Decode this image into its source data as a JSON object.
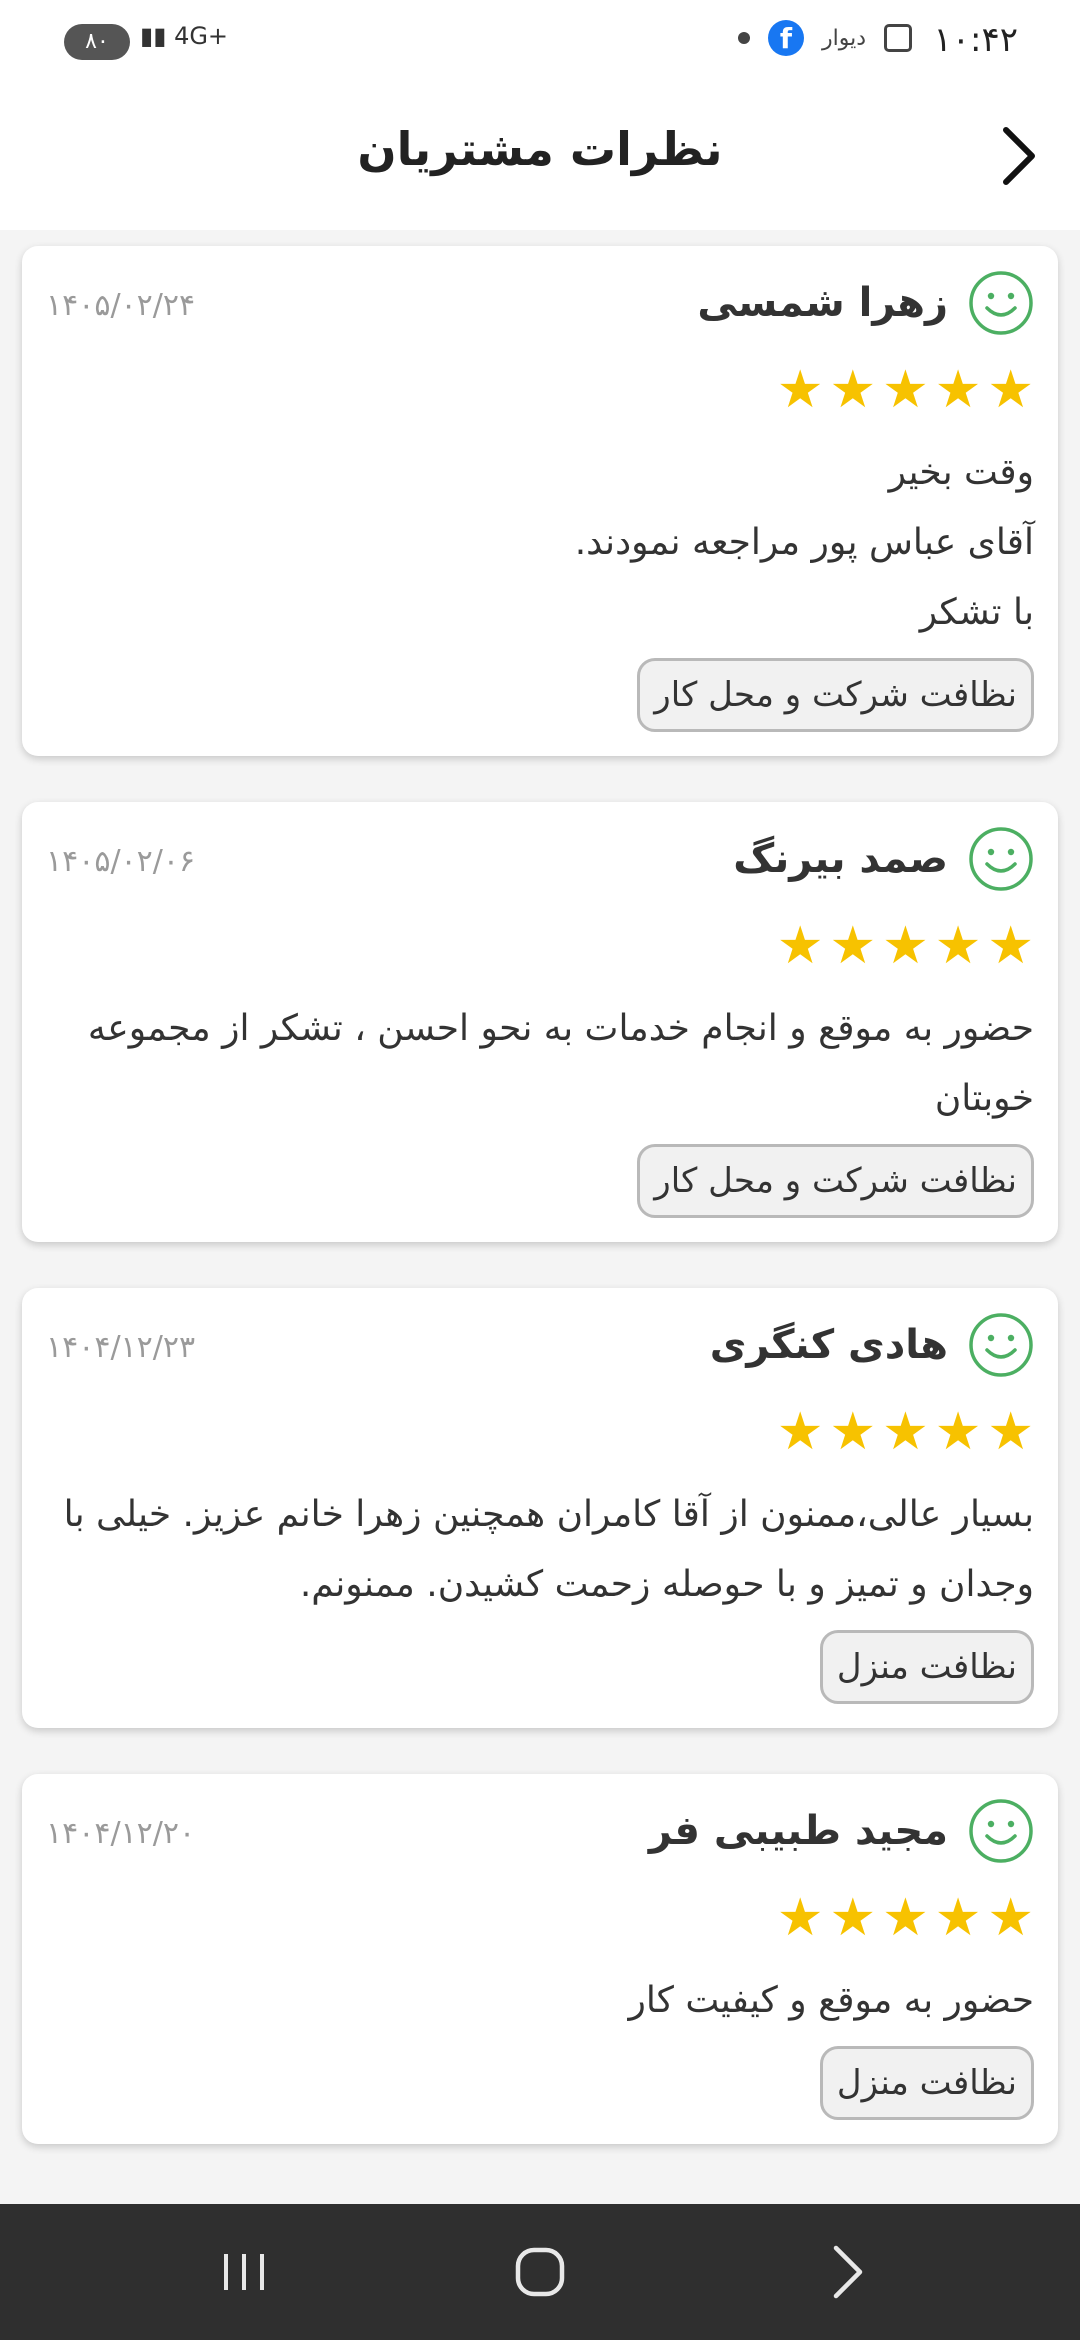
{
  "status_bar": {
    "time": "۱۰:۴۲",
    "battery": "۸۰",
    "network": "4G+",
    "app_label": "دیوار",
    "fb_glyph": "f"
  },
  "header": {
    "title": "نظرات مشتریان"
  },
  "reviews": [
    {
      "name": "زهرا شمسی",
      "date": "۱۴۰۵/۰۲/۲۴",
      "rating": 5,
      "comment": "وقت بخیر\nآقای عباس پور مراجعه نمودند.\nبا تشکر",
      "tag": "نظافت شرکت و محل کار"
    },
    {
      "name": "صمد بیرنگ",
      "date": "۱۴۰۵/۰۲/۰۶",
      "rating": 5,
      "comment": "حضور به موقع و انجام خدمات به نحو احسن ، تشکر از مجموعه خوبتان",
      "tag": "نظافت شرکت و محل کار"
    },
    {
      "name": "هادی کنگری",
      "date": "۱۴۰۴/۱۲/۲۳",
      "rating": 5,
      "comment": "بسیار عالی،ممنون از آقا کامران همچنین زهرا خانم عزیز. خیلی با وجدان و تمیز و با حوصله زحمت کشیدن. ممنونم.",
      "tag": "نظافت منزل"
    },
    {
      "name": "مجید طبیبی فر",
      "date": "۱۴۰۴/۱۲/۲۰",
      "rating": 5,
      "comment": "حضور به موقع و کیفیت کار",
      "tag": "نظافت منزل"
    }
  ],
  "colors": {
    "star": "#f7c200",
    "smiley": "#4caf62",
    "navbar": "#2f2f2f"
  },
  "icons": {
    "back": "chevron-right-icon",
    "smiley": "smiley-icon",
    "star": "star-icon",
    "nav_recent": "recent-apps-icon",
    "nav_home": "home-icon",
    "nav_back": "nav-back-icon"
  }
}
